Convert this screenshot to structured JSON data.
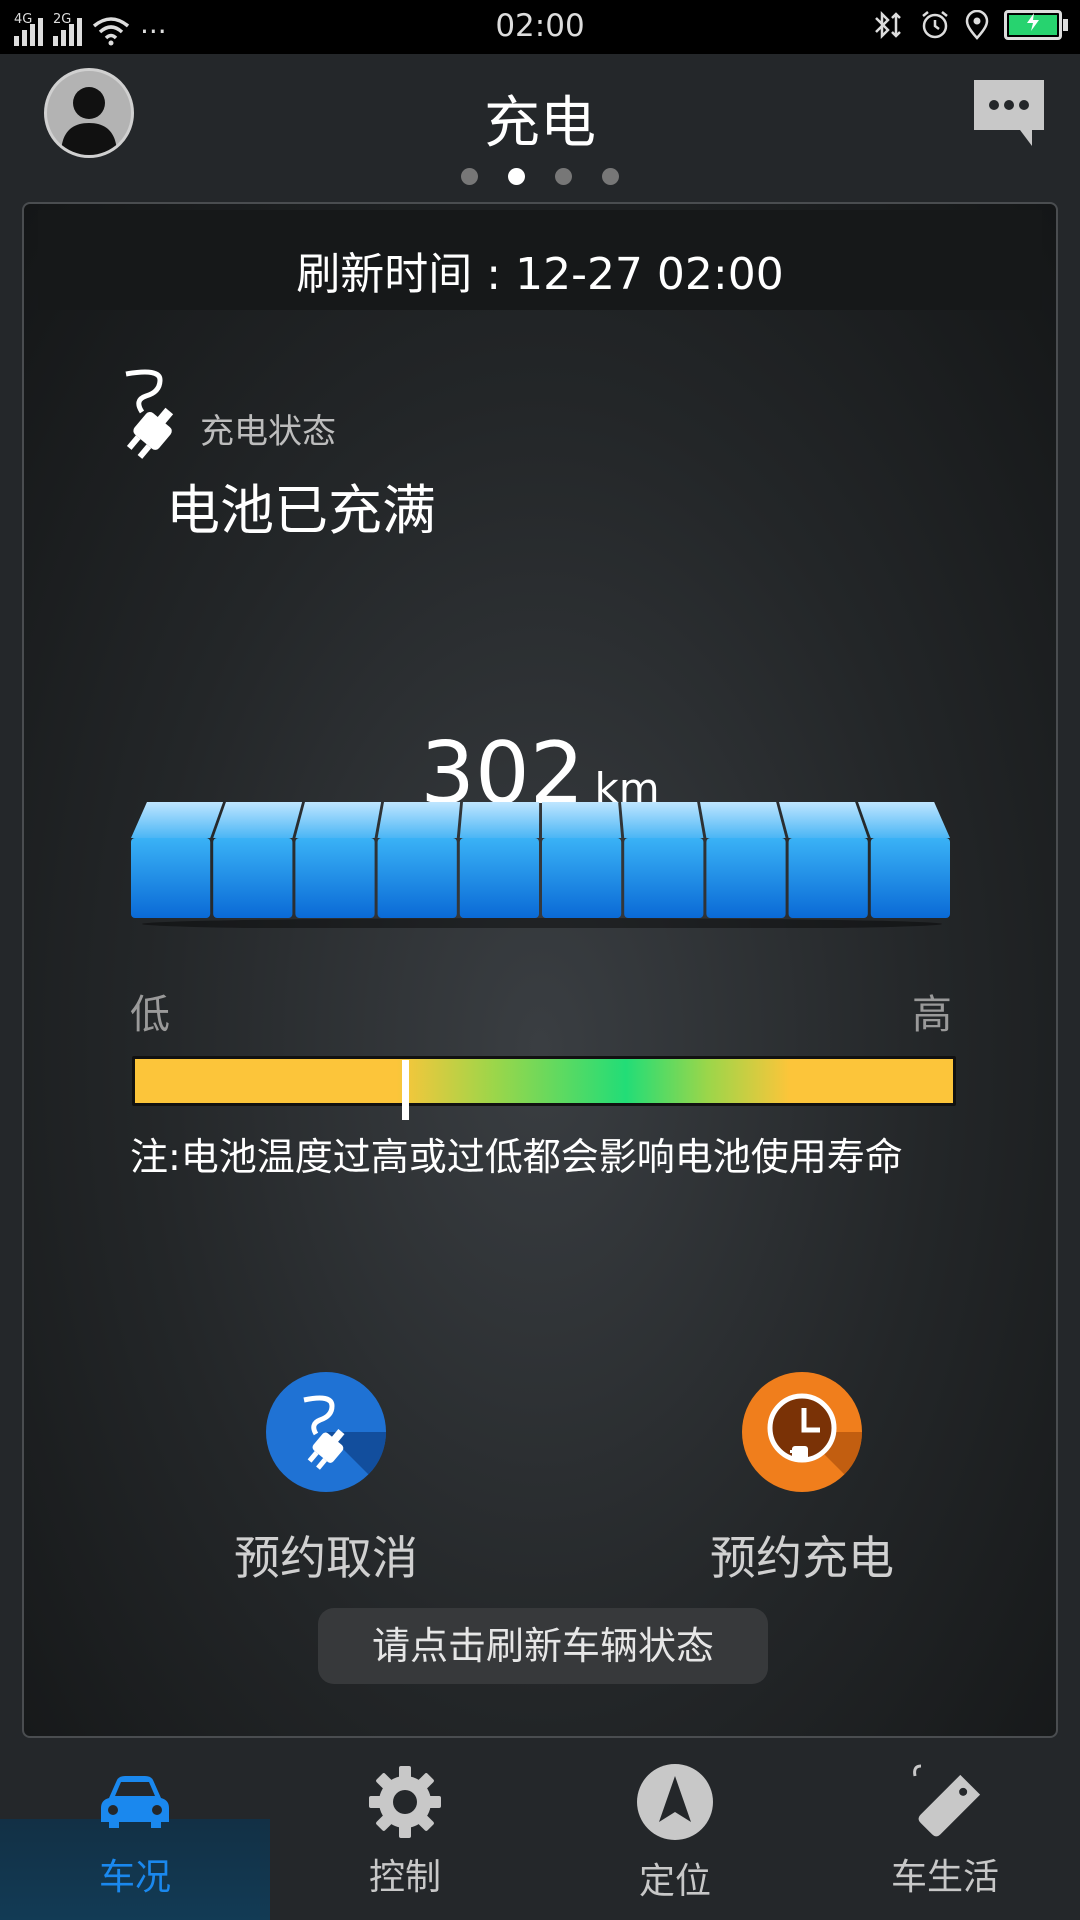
{
  "status_bar": {
    "network_1": "4G",
    "network_2": "2G",
    "overflow": "···",
    "time": "02:00",
    "icons": [
      "bluetooth-icon",
      "alarm-icon",
      "location-icon",
      "battery-icon"
    ],
    "battery_state": "charging"
  },
  "header": {
    "title": "充电",
    "page_indicator": {
      "total": 4,
      "active": 2
    }
  },
  "refresh": {
    "text": "刷新时间 : 12-27 02:00"
  },
  "charge_status": {
    "label": "充电状态",
    "value": "电池已充满"
  },
  "range": {
    "value": "302",
    "unit": "km",
    "battery_segments": 10,
    "battery_fill_fraction": 1.0
  },
  "temperature": {
    "low_label": "低",
    "high_label": "高",
    "marker_fraction": 0.33,
    "note": "注:电池温度过高或过低都会影响电池使用寿命"
  },
  "actions": {
    "cancel_label": "预约取消",
    "schedule_label": "预约充电",
    "cancel_color": "#1f72d4",
    "schedule_color": "#f07e1c"
  },
  "toast": {
    "text": "请点击刷新车辆状态"
  },
  "nav": {
    "items": [
      {
        "label": "车况",
        "icon": "car-icon",
        "active": true
      },
      {
        "label": "控制",
        "icon": "gear-icon",
        "active": false
      },
      {
        "label": "定位",
        "icon": "navigation-icon",
        "active": false
      },
      {
        "label": "车生活",
        "icon": "tag-icon",
        "active": false
      }
    ],
    "active_color": "#1a88ee"
  }
}
